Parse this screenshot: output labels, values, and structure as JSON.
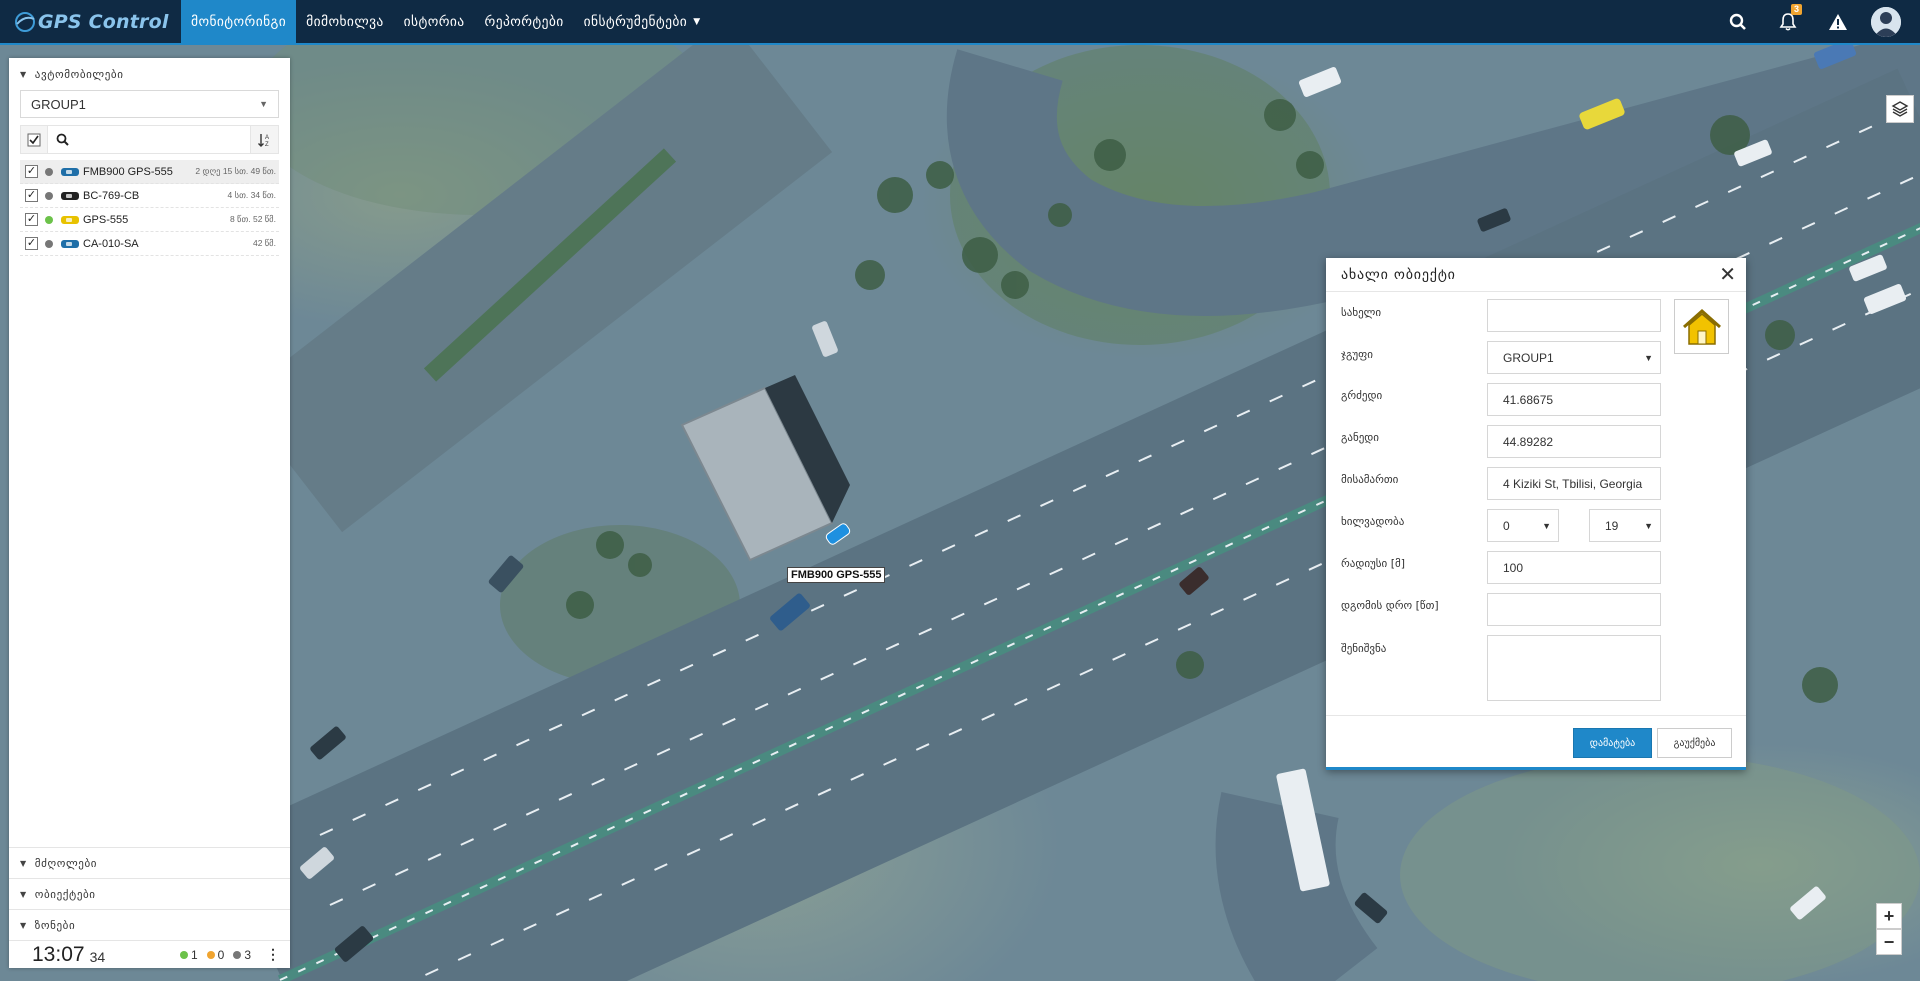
{
  "app": {
    "logo_text": "GPS Control"
  },
  "nav": {
    "items": [
      {
        "label": "მონიტორინგი",
        "active": true
      },
      {
        "label": "მიმოხილვა"
      },
      {
        "label": "ისტორია"
      },
      {
        "label": "რეპორტები"
      },
      {
        "label": "ინსტრუმენტები",
        "has_dropdown": true
      }
    ],
    "notification_count": "3",
    "icons": [
      "search-icon",
      "bell-icon",
      "warning-icon",
      "avatar"
    ]
  },
  "sidebar": {
    "vehicles_section": "ავტომობილები",
    "group_value": "GROUP1",
    "search_placeholder": "",
    "vehicles": [
      {
        "name": "FMB900 GPS-555",
        "time": "2 დღე 15 სთ. 49 წთ.",
        "status_color": "#777777",
        "car_color": "#1f6fa8",
        "checked": true,
        "selected": true
      },
      {
        "name": "BC-769-CB",
        "time": "4 სთ. 34 წთ.",
        "status_color": "#777777",
        "car_color": "#222222",
        "checked": true
      },
      {
        "name": "GPS-555",
        "time": "8 წთ. 52 წმ.",
        "status_color": "#6cc24a",
        "car_color": "#e8c200",
        "checked": true
      },
      {
        "name": "CA-010-SA",
        "time": "42 წმ.",
        "status_color": "#777777",
        "car_color": "#1f6fa8",
        "checked": true
      }
    ],
    "bottom_sections": [
      "მძღოლები",
      "ობიექტები",
      "ზონები"
    ],
    "clock": {
      "time": "13:07",
      "seconds": "34"
    },
    "counts": [
      {
        "value": "1",
        "color": "#6cc24a"
      },
      {
        "value": "0",
        "color": "#f0a430"
      },
      {
        "value": "3",
        "color": "#777777"
      }
    ]
  },
  "map": {
    "vehicle_label": "FMB900 GPS-555",
    "zoom_in": "+",
    "zoom_out": "−"
  },
  "dialog": {
    "title": "ახალი ობიექტი",
    "fields": {
      "name_label": "სახელი",
      "name_value": "",
      "group_label": "ჯგუფი",
      "group_value": "GROUP1",
      "lat_label": "გრძედი",
      "lat_value": "41.68675",
      "lng_label": "განედი",
      "lng_value": "44.89282",
      "address_label": "მისამართი",
      "address_value": "4 Kiziki St, Tbilisi, Georgia",
      "visibility_label": "ხილვადობა",
      "visibility_from": "0",
      "visibility_to": "19",
      "radius_label": "რადიუსი [მ]",
      "radius_value": "100",
      "stay_label": "დგომის დრო [წთ]",
      "stay_value": "",
      "note_label": "შენიშვნა",
      "note_value": ""
    },
    "icon": "house-icon",
    "add_button": "დამატება",
    "cancel_button": "გაუქმება"
  },
  "colors": {
    "nav_bg": "#0f2a44",
    "accent": "#1f88c9"
  }
}
